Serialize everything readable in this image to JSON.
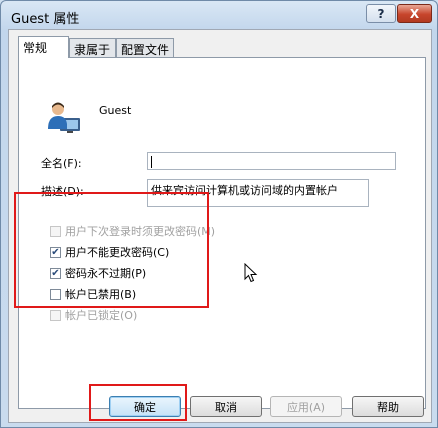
{
  "window": {
    "title": "Guest 属性",
    "help_button": "?",
    "close_button": "X"
  },
  "tabs": [
    {
      "label": "常规",
      "active": true
    },
    {
      "label": "隶属于",
      "active": false
    },
    {
      "label": "配置文件",
      "active": false
    }
  ],
  "general": {
    "username": "Guest",
    "full_name_label": "全名(F):",
    "full_name_value": "",
    "description_label": "描述(D):",
    "description_value": "供来宾访问计算机或访问域的内置帐户"
  },
  "options": [
    {
      "label": "用户下次登录时须更改密码(M)",
      "checked": false,
      "enabled": false
    },
    {
      "label": "用户不能更改密码(C)",
      "checked": true,
      "enabled": true
    },
    {
      "label": "密码永不过期(P)",
      "checked": true,
      "enabled": true
    },
    {
      "label": "帐户已禁用(B)",
      "checked": false,
      "enabled": true
    },
    {
      "label": "帐户已锁定(O)",
      "checked": false,
      "enabled": false
    }
  ],
  "buttons": {
    "ok": "确定",
    "cancel": "取消",
    "apply": "应用(A)",
    "help": "帮助"
  },
  "colors": {
    "highlight": "#e01919",
    "close_button": "#c7452c"
  }
}
